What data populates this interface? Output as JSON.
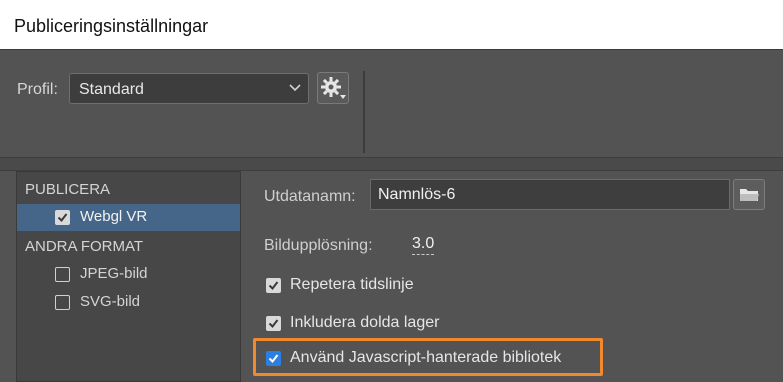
{
  "window": {
    "title": "Publiceringsinställningar"
  },
  "profile": {
    "label": "Profil:",
    "selected": "Standard"
  },
  "left_panel": {
    "section_publish": "PUBLICERA",
    "publish_items": [
      {
        "label": "Webgl VR",
        "checked": true,
        "selected": true
      }
    ],
    "section_other": "ANDRA FORMAT",
    "other_items": [
      {
        "label": "JPEG-bild",
        "checked": false
      },
      {
        "label": "SVG-bild",
        "checked": false
      }
    ]
  },
  "settings": {
    "output_name_label": "Utdatanamn:",
    "output_name_value": "Namnlös-6",
    "resolution_label": "Bildupplösning:",
    "resolution_value": "3.0",
    "options": [
      {
        "label": "Repetera tidslinje",
        "checked": true
      },
      {
        "label": "Inkludera dolda lager",
        "checked": true
      },
      {
        "label": "Använd Javascript-hanterade bibliotek",
        "checked": true,
        "highlighted": true
      }
    ]
  },
  "colors": {
    "highlight": "#f08a2c",
    "selection": "#466689",
    "checkbox_blue": "#2b7fe0"
  }
}
